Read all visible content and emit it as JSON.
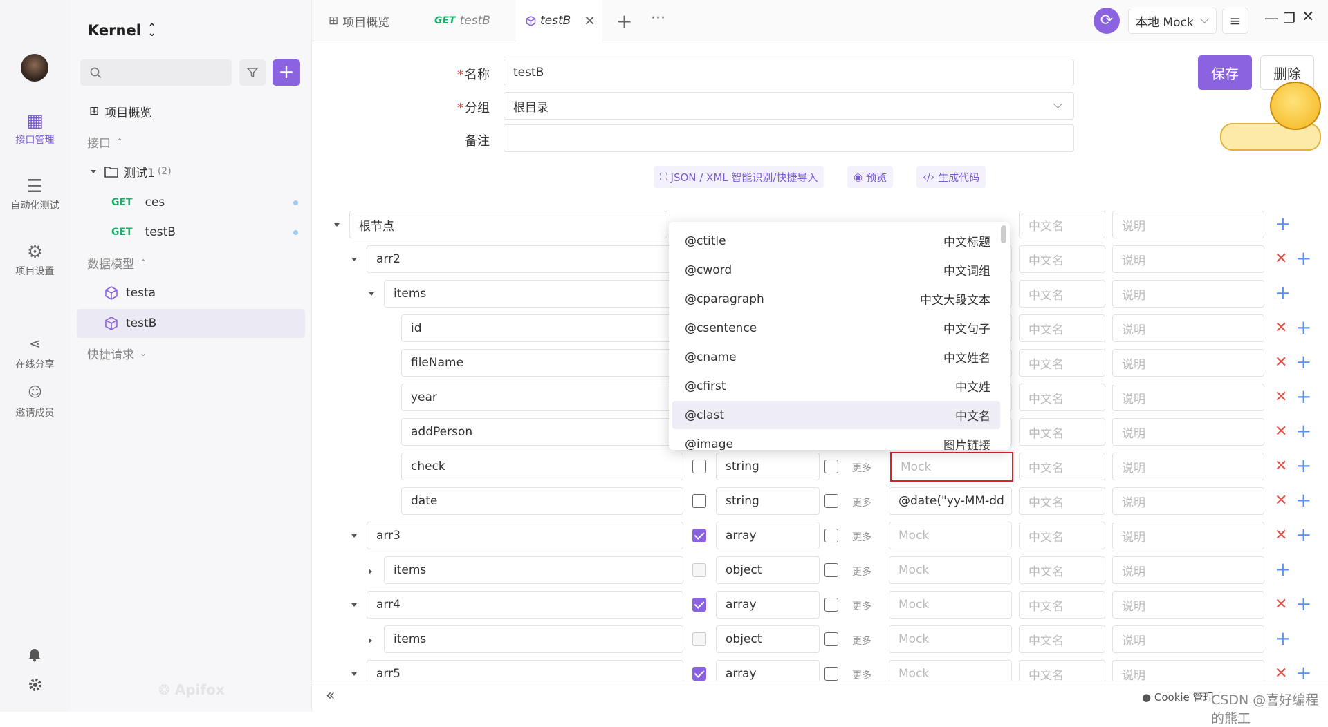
{
  "nav": {
    "items": [
      {
        "label": "接口管理",
        "icon": "api-management-icon",
        "active": true
      },
      {
        "label": "自动化测试",
        "icon": "automation-test-icon"
      },
      {
        "label": "项目设置",
        "icon": "project-settings-icon"
      },
      {
        "label": "在线分享",
        "icon": "share-icon"
      },
      {
        "label": "邀请成员",
        "icon": "invite-member-icon"
      }
    ]
  },
  "project": {
    "name": "Kernel",
    "overview": "项目概览",
    "section_api": "接口",
    "folder": {
      "name": "测试1",
      "count": "(2)"
    },
    "apis": [
      {
        "method": "GET",
        "name": "ces"
      },
      {
        "method": "GET",
        "name": "testB"
      }
    ],
    "section_models": "数据模型",
    "models": [
      {
        "name": "testa"
      },
      {
        "name": "testB",
        "selected": true
      }
    ],
    "section_quick": "快捷请求",
    "brand": "Apifox"
  },
  "tabs": [
    {
      "label": "项目概览"
    },
    {
      "method": "GET",
      "label": "testB"
    },
    {
      "label": "testB",
      "active": true
    }
  ],
  "header": {
    "env": "本地 Mock"
  },
  "form": {
    "name_label": "名称",
    "name_value": "testB",
    "group_label": "分组",
    "group_value": "根目录",
    "remark_label": "备注",
    "remark_value": "",
    "save": "保存",
    "delete": "删除",
    "tools": [
      "JSON / XML 智能识别/快捷导入",
      "预览",
      "生成代码"
    ]
  },
  "schema": {
    "placeholders": {
      "mock": "Mock",
      "cn_name": "中文名",
      "desc": "说明"
    },
    "more_label": "更多",
    "rows": [
      {
        "name": "根节点",
        "level": 0,
        "expand": "down",
        "type": "",
        "required": false,
        "mock": "",
        "delete": false
      },
      {
        "name": "arr2",
        "level": 1,
        "expand": "down",
        "type": "",
        "required": false,
        "mock": "",
        "delete": true
      },
      {
        "name": "items",
        "level": 2,
        "expand": "down",
        "type": "",
        "required": false,
        "mock": "",
        "delete": false
      },
      {
        "name": "id",
        "level": 3,
        "type": "",
        "mock": "",
        "delete": true
      },
      {
        "name": "fileName",
        "level": 3,
        "type": "",
        "mock": "",
        "delete": true
      },
      {
        "name": "year",
        "level": 3,
        "type": "",
        "mock": "",
        "delete": true
      },
      {
        "name": "addPerson",
        "level": 3,
        "type": "",
        "mock": "",
        "delete": true
      },
      {
        "name": "check",
        "level": 3,
        "type": "string",
        "required": false,
        "mock": "",
        "focused": true,
        "delete": true
      },
      {
        "name": "date",
        "level": 3,
        "type": "string",
        "required": false,
        "mock": "@date(\"yy-MM-dd",
        "delete": true
      },
      {
        "name": "arr3",
        "level": 1,
        "expand": "down",
        "type": "array",
        "required": true,
        "mock": "",
        "delete": true
      },
      {
        "name": "items",
        "level": 2,
        "expand": "right",
        "type": "object",
        "required": false,
        "disabled": true,
        "mock": "",
        "delete": false
      },
      {
        "name": "arr4",
        "level": 1,
        "expand": "down",
        "type": "array",
        "required": true,
        "mock": "",
        "delete": true
      },
      {
        "name": "items",
        "level": 2,
        "expand": "right",
        "type": "object",
        "required": false,
        "disabled": true,
        "mock": "",
        "delete": false
      },
      {
        "name": "arr5",
        "level": 1,
        "expand": "down",
        "type": "array",
        "required": true,
        "mock": "",
        "delete": true
      }
    ]
  },
  "mock_dropdown": [
    {
      "key": "@ctitle",
      "desc": "中文标题"
    },
    {
      "key": "@cword",
      "desc": "中文词组"
    },
    {
      "key": "@cparagraph",
      "desc": "中文大段文本"
    },
    {
      "key": "@csentence",
      "desc": "中文句子"
    },
    {
      "key": "@cname",
      "desc": "中文姓名"
    },
    {
      "key": "@cfirst",
      "desc": "中文姓"
    },
    {
      "key": "@clast",
      "desc": "中文名",
      "highlight": true
    },
    {
      "key": "@image",
      "desc": "图片链接"
    }
  ],
  "footer": {
    "watermark": "CSDN @喜好编程的熊工",
    "cookie": "Cookie 管理"
  },
  "colors": {
    "accent": "#8b63e0",
    "danger": "#e54d42",
    "add": "#5b8ff0",
    "get": "#1ab06b"
  }
}
